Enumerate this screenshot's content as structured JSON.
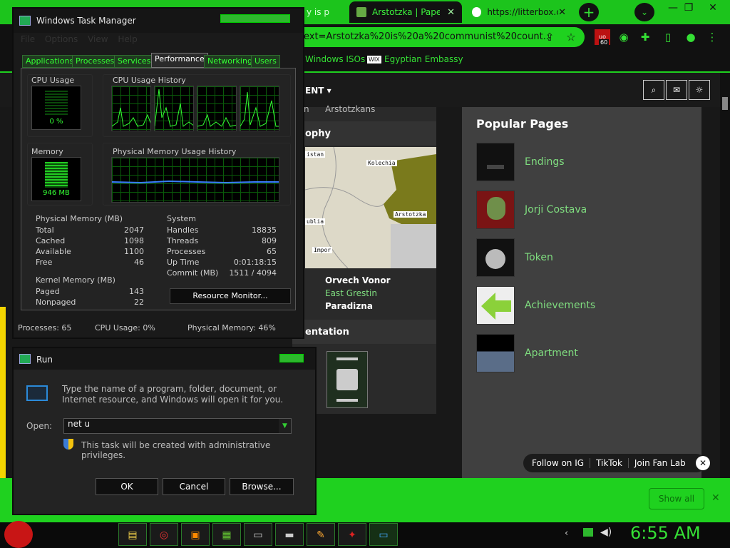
{
  "browser": {
    "tabs": [
      {
        "label": "y is p",
        "active": false
      },
      {
        "label": "Arstotzka | Paper",
        "active": true
      },
      {
        "label": "https://litterbox.c",
        "active": false
      }
    ],
    "url": "ext=Arstotzka%20is%20a%20communist%20count...",
    "extension_badge": "60",
    "bookmarks": [
      "Windows ISOs",
      "Egyptian Embassy"
    ],
    "bookmark_wix": "WIX",
    "site_nav_label": "ENT",
    "page_fragments": {
      "arstotzkans": "Arstotzkans",
      "ophy": "ophy",
      "entation": "entation",
      "n": "n"
    },
    "map_labels": [
      "istan",
      "Kolechia",
      "Arstotzka",
      "ublia",
      "Impor"
    ],
    "cities": [
      "Orvech Vonor",
      "East Grestin",
      "Paradizna"
    ],
    "popular_pages": {
      "title": "Popular Pages",
      "items": [
        "Endings",
        "Jorji Costava",
        "Token",
        "Achievements",
        "Apartment"
      ]
    },
    "follow": [
      "Follow on IG",
      "TikTok",
      "Join Fan Lab"
    ],
    "show_all": "Show all"
  },
  "taskmanager": {
    "title": "Windows Task Manager",
    "menu": [
      "File",
      "Options",
      "View",
      "Help"
    ],
    "tabs": [
      "Applications",
      "Processes",
      "Services",
      "Performance",
      "Networking",
      "Users"
    ],
    "cpu_usage_title": "CPU Usage",
    "cpu_value": "0 %",
    "cpu_history_title": "CPU Usage History",
    "memory_title": "Memory",
    "memory_value": "946 MB",
    "mem_history_title": "Physical Memory Usage History",
    "physical_memory": {
      "title": "Physical Memory (MB)",
      "rows": [
        {
          "k": "Total",
          "v": "2047"
        },
        {
          "k": "Cached",
          "v": "1098"
        },
        {
          "k": "Available",
          "v": "1100"
        },
        {
          "k": "Free",
          "v": "46"
        }
      ]
    },
    "kernel_memory": {
      "title": "Kernel Memory (MB)",
      "rows": [
        {
          "k": "Paged",
          "v": "143"
        },
        {
          "k": "Nonpaged",
          "v": "22"
        }
      ]
    },
    "system": {
      "title": "System",
      "rows": [
        {
          "k": "Handles",
          "v": "18835"
        },
        {
          "k": "Threads",
          "v": "809"
        },
        {
          "k": "Processes",
          "v": "65"
        },
        {
          "k": "Up Time",
          "v": "0:01:18:15"
        },
        {
          "k": "Commit (MB)",
          "v": "1511 / 4094"
        }
      ]
    },
    "resource_monitor": "Resource Monitor...",
    "status": {
      "processes": "Processes: 65",
      "cpu": "CPU Usage: 0%",
      "memory": "Physical Memory: 46%"
    }
  },
  "run": {
    "title": "Run",
    "description": "Type the name of a program, folder, document, or Internet resource, and Windows will open it for you.",
    "open_label": "Open:",
    "input_value": "net u",
    "admin_note": "This task will be created with administrative privileges.",
    "buttons": {
      "ok": "OK",
      "cancel": "Cancel",
      "browse": "Browse..."
    }
  },
  "taskbar": {
    "clock": "6:55 AM"
  },
  "colors": {
    "accent": "#1fd11f",
    "graph_line": "#33ff33",
    "link": "#7fdc7f"
  }
}
